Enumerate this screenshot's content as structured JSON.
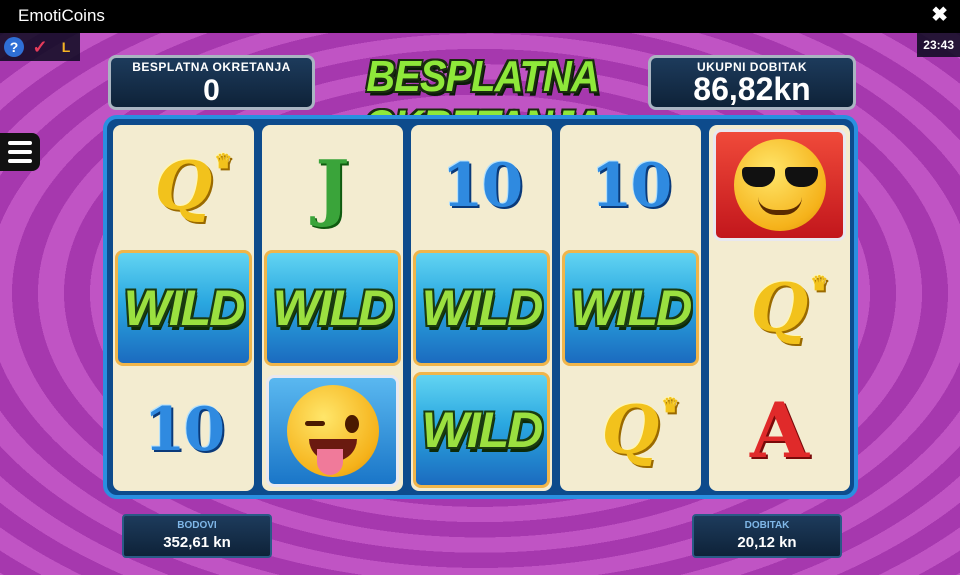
{
  "window": {
    "title": "EmotiCoins",
    "close_glyph": "✖"
  },
  "toolbar": {
    "help": {
      "glyph": "?",
      "icon": "help-icon"
    },
    "check": {
      "glyph": "✓",
      "icon": "check-icon"
    },
    "l": {
      "glyph": "L",
      "icon": "l-icon"
    }
  },
  "clock": "23:43",
  "free_spins": {
    "label": "BESPLATNA OKRETANJA",
    "value": "0"
  },
  "banner": "BESPLATNA OKRETANJA",
  "total_win": {
    "label": "UKUPNI DOBITAK",
    "value": "86,82kn"
  },
  "bottom": {
    "credits": {
      "label": "BODOVI",
      "value": "352,61 kn"
    },
    "win": {
      "label": "DOBITAK",
      "value": "20,12 kn"
    }
  },
  "symbols": {
    "wild": "WILD",
    "q": "Q",
    "j": "J",
    "ten": "10",
    "a": "A",
    "crown": "♛"
  },
  "reels": [
    [
      "Q",
      "WILD",
      "10"
    ],
    [
      "J",
      "WILD",
      "wink-emoji"
    ],
    [
      "10",
      "WILD",
      "WILD"
    ],
    [
      "10",
      "WILD",
      "Q"
    ],
    [
      "sunglasses-emoji",
      "Q",
      "A"
    ]
  ],
  "colors": {
    "reel_frame": "#0d4b8c",
    "wild_text": "#9be040",
    "background": "#b048b8"
  }
}
